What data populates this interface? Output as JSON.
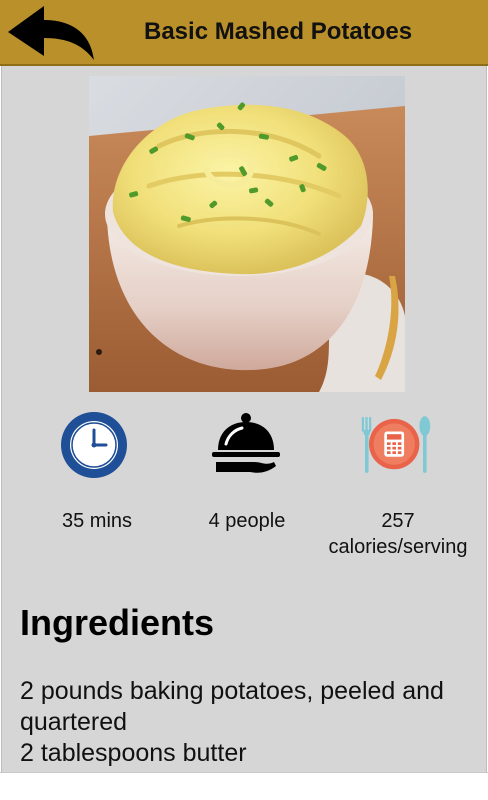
{
  "header": {
    "title": "Basic Mashed Potatoes",
    "back_icon": "back-arrow-icon",
    "accent_color": "#b9902a"
  },
  "recipe": {
    "photo_subject": "mashed-potatoes-photo",
    "stats": [
      {
        "icon": "clock-icon",
        "label": "35 mins"
      },
      {
        "icon": "serving-cloche-icon",
        "label": "4 people"
      },
      {
        "icon": "calorie-calculator-icon",
        "label": "257 calories/serving"
      }
    ],
    "ingredients_heading": "Ingredients",
    "ingredients": [
      "2 pounds baking potatoes, peeled and quartered",
      "2 tablespoons butter"
    ]
  }
}
